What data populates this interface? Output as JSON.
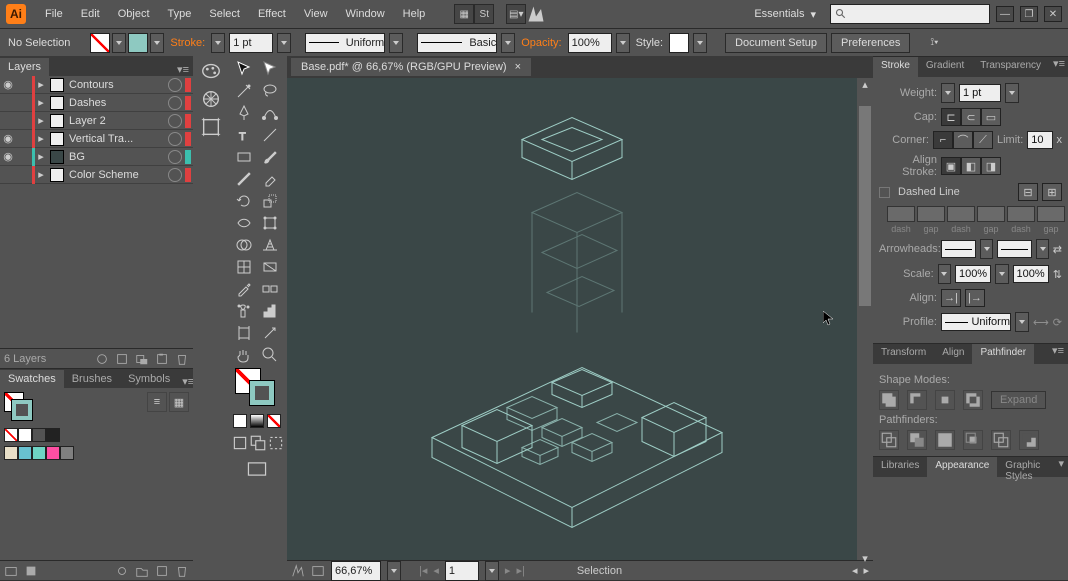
{
  "app_name": "Ai",
  "menu": [
    "File",
    "Edit",
    "Object",
    "Type",
    "Select",
    "Effect",
    "View",
    "Window",
    "Help"
  ],
  "workspace": "Essentials",
  "search_placeholder": "",
  "ctrl": {
    "selection": "No Selection",
    "stroke_label": "Stroke:",
    "stroke_weight": "1 pt",
    "profile": "Uniform",
    "brush": "Basic",
    "opacity_label": "Opacity:",
    "opacity": "100%",
    "style_label": "Style:",
    "doc_setup": "Document Setup",
    "prefs": "Preferences"
  },
  "doc_tab": "Base.pdf* @ 66,67% (RGB/GPU Preview)",
  "layers_tab": "Layers",
  "layers": [
    {
      "name": "Contours",
      "color": "#e04040"
    },
    {
      "name": "Dashes",
      "color": "#e04040"
    },
    {
      "name": "Layer 2",
      "color": "#e04040"
    },
    {
      "name": "Vertical Tra...",
      "color": "#e04040"
    },
    {
      "name": "BG",
      "color": "#3bbfae"
    },
    {
      "name": "Color Scheme",
      "color": "#e04040"
    }
  ],
  "layer_count": "6 Layers",
  "swatch_tabs": [
    "Swatches",
    "Brushes",
    "Symbols"
  ],
  "swatch_row1": [
    "#ffffff",
    "#222222"
  ],
  "swatch_row2": [
    "#e8dfc8",
    "#69c2d1",
    "#6fd4c4",
    "#ff4fa3",
    "#808080"
  ],
  "stroke_panel": {
    "tabs": [
      "Stroke",
      "Gradient",
      "Transparency"
    ],
    "weight_label": "Weight:",
    "weight": "1 pt",
    "cap_label": "Cap:",
    "corner_label": "Corner:",
    "limit_label": "Limit:",
    "limit": "10",
    "limit_x": "x",
    "align_label": "Align Stroke:",
    "dashed_label": "Dashed Line",
    "dash_cols": [
      "dash",
      "gap",
      "dash",
      "gap",
      "dash",
      "gap"
    ],
    "arrow_label": "Arrowheads:",
    "scale_label": "Scale:",
    "scale1": "100%",
    "scale2": "100%",
    "align_arrow_label": "Align:",
    "profile_label": "Profile:",
    "profile": "Uniform"
  },
  "align_tabs": [
    "Transform",
    "Align",
    "Pathfinder"
  ],
  "shape_modes": "Shape Modes:",
  "expand": "Expand",
  "pathfinders": "Pathfinders:",
  "lib_tabs": [
    "Libraries",
    "Appearance",
    "Graphic Styles"
  ],
  "status": {
    "zoom": "66,67%",
    "page": "1",
    "tool": "Selection"
  }
}
